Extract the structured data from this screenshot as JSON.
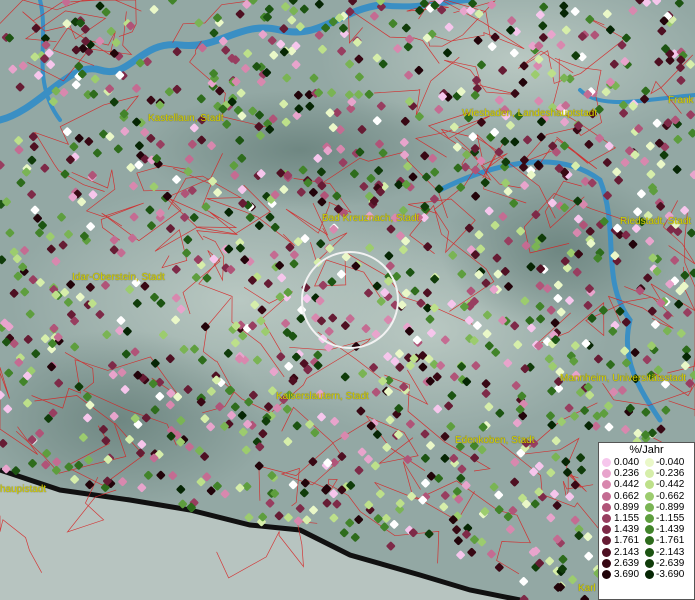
{
  "map": {
    "places": [
      {
        "name": "Kastellaun, Stadt"
      },
      {
        "name": "Wiesbaden, Landeshauptstadt"
      },
      {
        "name": "Frank"
      },
      {
        "name": "Bad Kreuznach, Stadt"
      },
      {
        "name": "Riedstadt, Stadt"
      },
      {
        "name": "Idar-Oberstein, Stadt"
      },
      {
        "name": "Kaiserslautern, Stadt"
      },
      {
        "name": "Mannheim, Universitätsstadt"
      },
      {
        "name": "Edenkoben, Stadt"
      },
      {
        "name": "haupistadt"
      },
      {
        "name": "Karl"
      }
    ],
    "colors": {
      "river": "#3a8fc4",
      "border": "#d82020",
      "place_label": "#d8d200"
    }
  },
  "legend": {
    "title": "%/Jahr",
    "rows": [
      {
        "pos": "0.040",
        "pos_color": "#f6c6ec",
        "neg": "-0.040",
        "neg_color": "#eaf8c8"
      },
      {
        "pos": "0.236",
        "pos_color": "#e8a4cc",
        "neg": "-0.236",
        "neg_color": "#d6eeaa"
      },
      {
        "pos": "0.442",
        "pos_color": "#d888ae",
        "neg": "-0.442",
        "neg_color": "#bde08a"
      },
      {
        "pos": "0.662",
        "pos_color": "#c46c92",
        "neg": "-0.662",
        "neg_color": "#9ccc6e"
      },
      {
        "pos": "0.899",
        "pos_color": "#b05478",
        "neg": "-0.899",
        "neg_color": "#7ab454"
      },
      {
        "pos": "1.155",
        "pos_color": "#983e60",
        "neg": "-1.155",
        "neg_color": "#5e9e3e"
      },
      {
        "pos": "1.439",
        "pos_color": "#7e2a48",
        "neg": "-1.439",
        "neg_color": "#42842a"
      },
      {
        "pos": "1.761",
        "pos_color": "#661c34",
        "neg": "-1.761",
        "neg_color": "#2e6c1c"
      },
      {
        "pos": "2.143",
        "pos_color": "#4e1022",
        "neg": "-2.143",
        "neg_color": "#1c5412"
      },
      {
        "pos": "2.639",
        "pos_color": "#380814",
        "neg": "-2.639",
        "neg_color": "#103c0a"
      },
      {
        "pos": "3.690",
        "pos_color": "#22040a",
        "neg": "-3.690",
        "neg_color": "#062604"
      }
    ]
  }
}
